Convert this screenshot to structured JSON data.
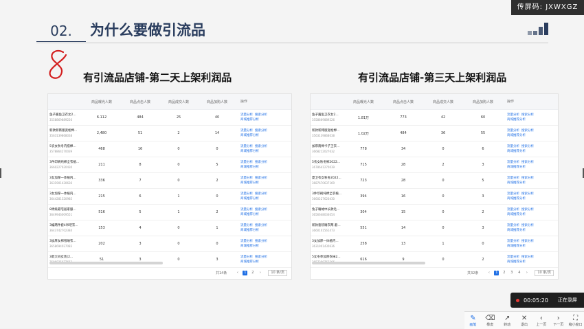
{
  "share_code": "传屏码: JXWXGZ",
  "heading": {
    "number": "02.",
    "title": "为什么要做引流品"
  },
  "annotation_mark": "8",
  "left": {
    "subtitle": "有引流品店铺-第二天上架利润品",
    "columns": [
      "商品曝光人数",
      "商品点击人数",
      "商品成交人数",
      "商品加购人数",
      "操作"
    ],
    "rows": [
      {
        "name": "鱼子酱鱼卫衣女2...",
        "id": "3558869889226",
        "v": [
          "6.112",
          "484",
          "25",
          "40"
        ]
      },
      {
        "name": "新款新韩版宽松棉...",
        "id": "3563139868038",
        "v": [
          "2,480",
          "51",
          "2",
          "14"
        ]
      },
      {
        "name": "5农女秋冬内搭棉...",
        "id": "3578864270039",
        "v": [
          "468",
          "16",
          "0",
          "0"
        ]
      },
      {
        "name": "3件印刷纯棉全衣植...",
        "id": "3660227620430",
        "v": [
          "211",
          "8",
          "0",
          "5"
        ]
      },
      {
        "name": "3女加厚一体植内...",
        "id": "3631901430636",
        "v": [
          "336",
          "7",
          "0",
          "2"
        ]
      },
      {
        "name": "3女加厚一体植内...",
        "id": "3644281320985",
        "v": [
          "215",
          "6",
          "1",
          "0"
        ]
      },
      {
        "name": "8周级最宅居家服...",
        "id": "3649946009551",
        "v": [
          "516",
          "5",
          "1",
          "2"
        ]
      },
      {
        "name": "3编两件套4吊吧衣...",
        "id": "3643742702384",
        "v": [
          "153",
          "4",
          "0",
          "1"
        ]
      },
      {
        "name": "3加厚女棉毯睡衣...",
        "id": "3658694027083",
        "v": [
          "202",
          "3",
          "0",
          "0"
        ]
      },
      {
        "name": "3款大码女装(2...",
        "id": "3596035677663",
        "v": [
          "51",
          "3",
          "0",
          "3"
        ]
      }
    ],
    "ops": [
      "流量分析",
      "搜索分析",
      "商城推荐分析"
    ],
    "pager": {
      "total": "共14条",
      "pages": [
        "1",
        "2"
      ],
      "page_size": "10 条/页"
    }
  },
  "right": {
    "subtitle": "有引流品店铺-第三天上架利润品",
    "columns": [
      "商品曝光人数",
      "商品点击人数",
      "商品成交人数",
      "商品加购人数",
      "操作"
    ],
    "rows": [
      {
        "name": "鱼子酱鱼卫衣女2...",
        "id": "3558869889226",
        "v": [
          "1.81万",
          "773",
          "42",
          "60"
        ]
      },
      {
        "name": "新款新韩版宽松棉...",
        "id": "3563139868038",
        "v": [
          "1.02万",
          "484",
          "36",
          "55"
        ]
      },
      {
        "name": "加厚南棉卡子卫衣...",
        "id": "3668212027632",
        "v": [
          "778",
          "34",
          "0",
          "6"
        ]
      },
      {
        "name": "5农女秋冬裤2022...",
        "id": "3678641270039",
        "v": [
          "715",
          "28",
          "2",
          "3"
        ]
      },
      {
        "name": "夏卫衣女秋冬2022...",
        "id": "3687670637169",
        "v": [
          "723",
          "28",
          "0",
          "5"
        ]
      },
      {
        "name": "3件印刷纯棉全衣植...",
        "id": "3660227620430",
        "v": [
          "394",
          "16",
          "0",
          "3"
        ]
      },
      {
        "name": "兔子睡绒中长款毛...",
        "id": "3656648034054",
        "v": [
          "304",
          "15",
          "0",
          "2"
        ]
      },
      {
        "name": "新款套装睡衣两.套...",
        "id": "3660101561473",
        "v": [
          "551",
          "14",
          "0",
          "3"
        ]
      },
      {
        "name": "3女加厚一体植内...",
        "id": "3631901430636",
        "v": [
          "258",
          "13",
          "1",
          "0"
        ]
      },
      {
        "name": "5女冬季加厚衣袜2...",
        "id": "3657380763366",
        "v": [
          "616",
          "9",
          "0",
          "2"
        ]
      }
    ],
    "ops": [
      "流量分析",
      "搜索分析",
      "商城推荐分析"
    ],
    "pager": {
      "total": "共32条",
      "pages": [
        "1",
        "2",
        "3",
        "4"
      ],
      "page_size": "10 条/页"
    }
  },
  "recording": {
    "time": "00:05:20",
    "status": "正在录屏"
  },
  "toolbar": [
    {
      "icon": "✎",
      "label": "画笔",
      "name": "pen-tool"
    },
    {
      "icon": "⌫",
      "label": "橡皮",
      "name": "eraser-tool"
    },
    {
      "icon": "↗",
      "label": "转动",
      "name": "pointer-tool"
    },
    {
      "icon": "✕",
      "label": "退出",
      "name": "exit-tool"
    },
    {
      "icon": "‹",
      "label": "上一页",
      "name": "prev-page-tool"
    },
    {
      "icon": "›",
      "label": "下一页",
      "name": "next-page-tool"
    },
    {
      "icon": "⛶",
      "label": "缩小窗口",
      "name": "shrink-window-tool"
    }
  ],
  "colors": {
    "accent": "#1f6fe5",
    "heading": "#2a3d5e",
    "annotation": "#d32020"
  }
}
